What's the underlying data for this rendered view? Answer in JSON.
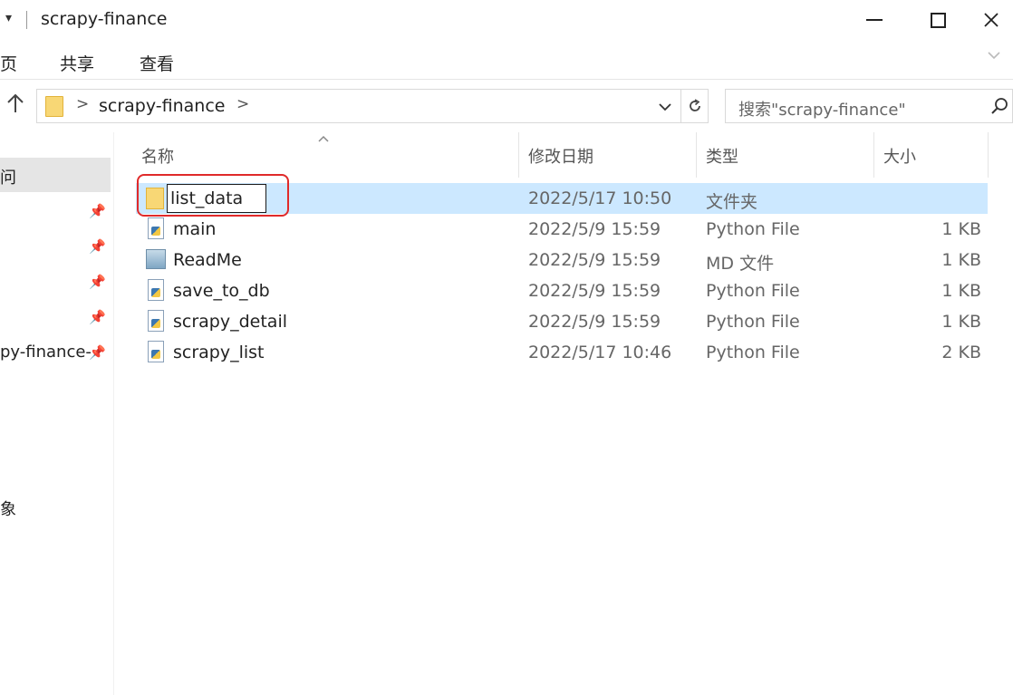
{
  "window": {
    "title": "scrapy-finance",
    "quick_access_glyph": "▾"
  },
  "ribbon": {
    "tabs": [
      "页",
      "共享",
      "查看"
    ]
  },
  "address_bar": {
    "path": "scrapy-finance",
    "separator": ">",
    "search_placeholder": "搜索\"scrapy-finance\""
  },
  "nav_pane": {
    "quick_access_label": "问",
    "items": [
      {
        "label": "",
        "pinned": true
      },
      {
        "label": "",
        "pinned": true
      },
      {
        "label": "",
        "pinned": true
      },
      {
        "label": "",
        "pinned": true
      },
      {
        "label": "py-finance-",
        "pinned": true
      }
    ],
    "other_label": "象"
  },
  "columns": {
    "name": "名称",
    "modified": "修改日期",
    "type": "类型",
    "size": "大小"
  },
  "files": [
    {
      "name": "list_data",
      "modified": "2022/5/17 10:50",
      "type": "文件夹",
      "size": "",
      "icon": "folder-icon",
      "renaming": true
    },
    {
      "name": "main",
      "modified": "2022/5/9 15:59",
      "type": "Python File",
      "size": "1 KB",
      "icon": "python-file-icon"
    },
    {
      "name": "ReadMe",
      "modified": "2022/5/9 15:59",
      "type": "MD 文件",
      "size": "1 KB",
      "icon": "markdown-file-icon"
    },
    {
      "name": "save_to_db",
      "modified": "2022/5/9 15:59",
      "type": "Python File",
      "size": "1 KB",
      "icon": "python-file-icon"
    },
    {
      "name": "scrapy_detail",
      "modified": "2022/5/9 15:59",
      "type": "Python File",
      "size": "1 KB",
      "icon": "python-file-icon"
    },
    {
      "name": "scrapy_list",
      "modified": "2022/5/17 10:46",
      "type": "Python File",
      "size": "2 KB",
      "icon": "python-file-icon"
    }
  ],
  "colors": {
    "selection": "#cce8ff",
    "highlight": "#e02a2a",
    "folder": "#f8d775"
  }
}
